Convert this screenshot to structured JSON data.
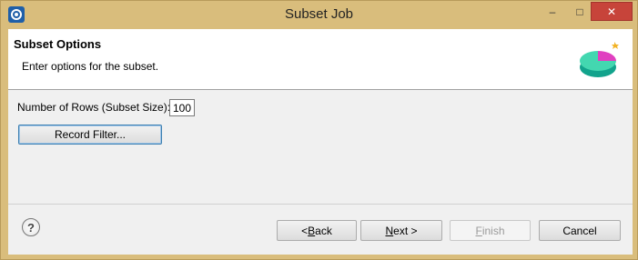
{
  "window": {
    "title": "Subset Job",
    "controls": {
      "minimize": "–",
      "maximize": "□",
      "close": "✕"
    },
    "frame_color": "#d9bd7c",
    "close_color": "#c7443a"
  },
  "banner": {
    "title": "Subset Options",
    "description": "Enter options for the subset.",
    "art_icon": "pie-chart-wizard-icon"
  },
  "form": {
    "rows_label": "Number of Rows (Subset Size):",
    "rows_value": "100",
    "record_filter_label": "Record Filter..."
  },
  "footer": {
    "help_glyph": "?",
    "back": {
      "prefix": "< ",
      "mnemonic": "B",
      "rest": "ack"
    },
    "next": {
      "mnemonic": "N",
      "rest": "ext >"
    },
    "finish": {
      "mnemonic": "F",
      "rest": "inish",
      "enabled": false
    },
    "cancel": "Cancel"
  }
}
